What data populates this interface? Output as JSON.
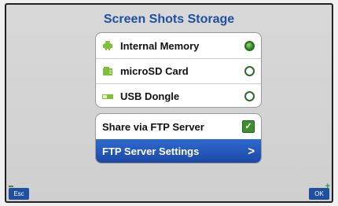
{
  "title": "Screen Shots Storage",
  "storage": {
    "options": [
      {
        "label": "Internal Memory",
        "selected": true,
        "icon": "android-icon"
      },
      {
        "label": "microSD Card",
        "selected": false,
        "icon": "sd-card-icon"
      },
      {
        "label": "USB Dongle",
        "selected": false,
        "icon": "usb-icon"
      }
    ]
  },
  "ftp": {
    "share_label": "Share via FTP Server",
    "share_checked": true,
    "settings_label": "FTP Server Settings",
    "settings_chevron": ">"
  },
  "softkeys": {
    "esc": "Esc",
    "ok": "OK",
    "ok_plus": "+"
  },
  "colors": {
    "title": "#1f4fa0",
    "accent_blue": "#1f4fa0",
    "selected_green": "#2d8a23"
  }
}
